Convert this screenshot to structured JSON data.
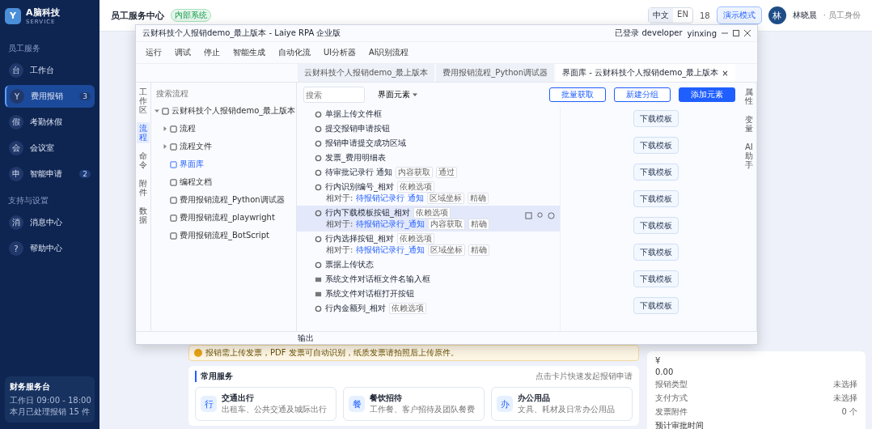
{
  "sidebar": {
    "logo": "Y",
    "brand": "A脑科技",
    "brand_sub": "SERVICE",
    "sections": [
      {
        "title": "员工服务",
        "items": [
          {
            "icon": "台",
            "label": "工作台",
            "selected": false
          },
          {
            "icon": "Y",
            "label": "费用报销",
            "selected": true,
            "badge": "3"
          },
          {
            "icon": "假",
            "label": "考勤休假",
            "selected": false
          },
          {
            "icon": "会",
            "label": "会议室",
            "selected": false
          },
          {
            "icon": "申",
            "label": "智能申请",
            "selected": false,
            "badge": "2"
          }
        ]
      },
      {
        "title": "支持与设置",
        "items": [
          {
            "icon": "消",
            "label": "消息中心",
            "selected": false
          },
          {
            "icon": "?",
            "label": "帮助中心",
            "selected": false
          }
        ]
      }
    ],
    "footer_card": {
      "title": "财务服务台",
      "lines": [
        "工作日 09:00 - 18:00",
        "本月已处理报销 15 件"
      ]
    }
  },
  "header": {
    "title": "员工服务中心",
    "badge": "内部系统",
    "lang": [
      {
        "label": "中文",
        "selected": true
      },
      {
        "label": "EN",
        "selected": false
      }
    ],
    "notice": "18",
    "demo_button": "演示模式",
    "avatar": "林",
    "user": "林晓晨",
    "role": "· 员工身份"
  },
  "page": {
    "alert": "报销需上传发票，PDF 发票可自动识别，纸质发票请拍照后上传原件。",
    "section_title": "常用服务",
    "section_link": "点击卡片快速发起报销申请",
    "cards": [
      {
        "icon": "行",
        "title": "交通出行",
        "desc": "出租车、公共交通及城际出行"
      },
      {
        "icon": "餐",
        "title": "餐饮招待",
        "desc": "工作餐、客户招待及团队餐费"
      },
      {
        "icon": "办",
        "title": "办公用品",
        "desc": "文具、耗材及日常办公用品"
      }
    ],
    "summary": {
      "symbol": "¥",
      "amount": "0.00",
      "rows": [
        {
          "label": "报销类型",
          "value": "未选择"
        },
        {
          "label": "支付方式",
          "value": "未选择"
        },
        {
          "label": "发票附件",
          "value": "0 个"
        }
      ],
      "footer": "预计审批时间"
    }
  },
  "rpa_window": {
    "title": "云财科技个人报销demo_最上版本 - Laiye RPA 企业版",
    "login": "已登录 developer",
    "user": "yinxing",
    "toolbar": [
      {
        "label": "运行"
      },
      {
        "label": "调试"
      },
      {
        "label": "停止"
      },
      {
        "label": "智能生成"
      },
      {
        "label": "自动化流"
      },
      {
        "label": "UI分析器"
      },
      {
        "label": "AI识别流程"
      }
    ],
    "tabs": [
      {
        "label": "云财科技个人报销demo_最上版本",
        "selected": false
      },
      {
        "label": "费用报销流程_Python调试器",
        "selected": false
      },
      {
        "label": "界面库 - 云财科技个人报销demo_最上版本",
        "selected": true,
        "close": "×"
      }
    ],
    "side_tabs": [
      {
        "label": "工作区",
        "selected": false
      },
      {
        "label": "流程",
        "selected": true
      },
      {
        "label": "命令",
        "selected": false
      },
      {
        "label": "附件",
        "selected": false
      },
      {
        "label": "数据",
        "selected": false
      }
    ],
    "tree_search": {
      "placeholder": "搜索流程"
    },
    "tree": [
      {
        "label": "云财科技个人报销demo_最上版本",
        "expanded": true,
        "selected": false,
        "children": [
          {
            "label": "流程",
            "expanded": false,
            "selected": false
          },
          {
            "label": "流程文件",
            "expanded": false,
            "selected": false
          },
          {
            "label": "界面库",
            "selected": true
          },
          {
            "label": "编程文档",
            "selected": false
          },
          {
            "label": "费用报销流程_Python调试器",
            "selected": false
          },
          {
            "label": "费用报销流程_playwright",
            "selected": false
          },
          {
            "label": "费用报销流程_BotScript",
            "selected": false
          }
        ]
      }
    ],
    "content": {
      "search": {
        "placeholder": "搜索"
      },
      "filter": "界面元素",
      "buttons": [
        {
          "label": "批量获取",
          "kind": "outline"
        },
        {
          "label": "新建分组",
          "kind": "outline"
        },
        {
          "label": "添加元素",
          "kind": "primary"
        }
      ],
      "elements": [
        {
          "kind": "element",
          "name": "单据上传文件框",
          "hovered": false
        },
        {
          "kind": "element",
          "name": "提交报销申请按钮",
          "hovered": false
        },
        {
          "kind": "element",
          "name": "报销申请提交成功区域",
          "hovered": false
        },
        {
          "kind": "element",
          "name": "发票_费用明细表",
          "hovered": false
        },
        {
          "kind": "element",
          "name": "待审批记录行 通知",
          "tags": [
            "内容获取",
            "通过"
          ],
          "hovered": false
        },
        {
          "kind": "element",
          "name": "行内识别编号_相对",
          "tags": [
            "依赖选项"
          ],
          "relative": {
            "prefix": "相对于:",
            "target": "待报销记录行 通知",
            "tags": [
              "区域坐标",
              "精确"
            ]
          },
          "hovered": false
        },
        {
          "kind": "element",
          "name": "行内下载模板按钮_相对",
          "tags": [
            "依赖选项"
          ],
          "relative": {
            "prefix": "相对于:",
            "target": "待报销记录行_通知",
            "tags": [
              "内容获取",
              "精确"
            ]
          },
          "hovered": true
        },
        {
          "kind": "element",
          "name": "行内选择按钮_相对",
          "tags": [
            "依赖选项"
          ],
          "relative": {
            "prefix": "相对于:",
            "target": "待报销记录行_通知",
            "tags": [
              "区域坐标",
              "精确"
            ]
          },
          "hovered": false
        },
        {
          "kind": "element",
          "name": "票据上传状态",
          "hovered": false
        },
        {
          "kind": "dialog",
          "name": "系统文件对话框文件名输入框",
          "hovered": false
        },
        {
          "kind": "dialog",
          "name": "系统文件对话框打开按钮",
          "hovered": false
        },
        {
          "kind": "element",
          "name": "行内金额列_相对",
          "tags": [
            "依赖选项"
          ],
          "hovered": false
        }
      ],
      "previews": [
        "下载模板",
        "下载模板",
        "下载模板",
        "下载模板",
        "下载模板",
        "下载模板",
        "下载模板",
        "下载模板"
      ]
    },
    "right_tabs": [
      "属性",
      "变量",
      "AI助手"
    ],
    "output": "输出"
  }
}
